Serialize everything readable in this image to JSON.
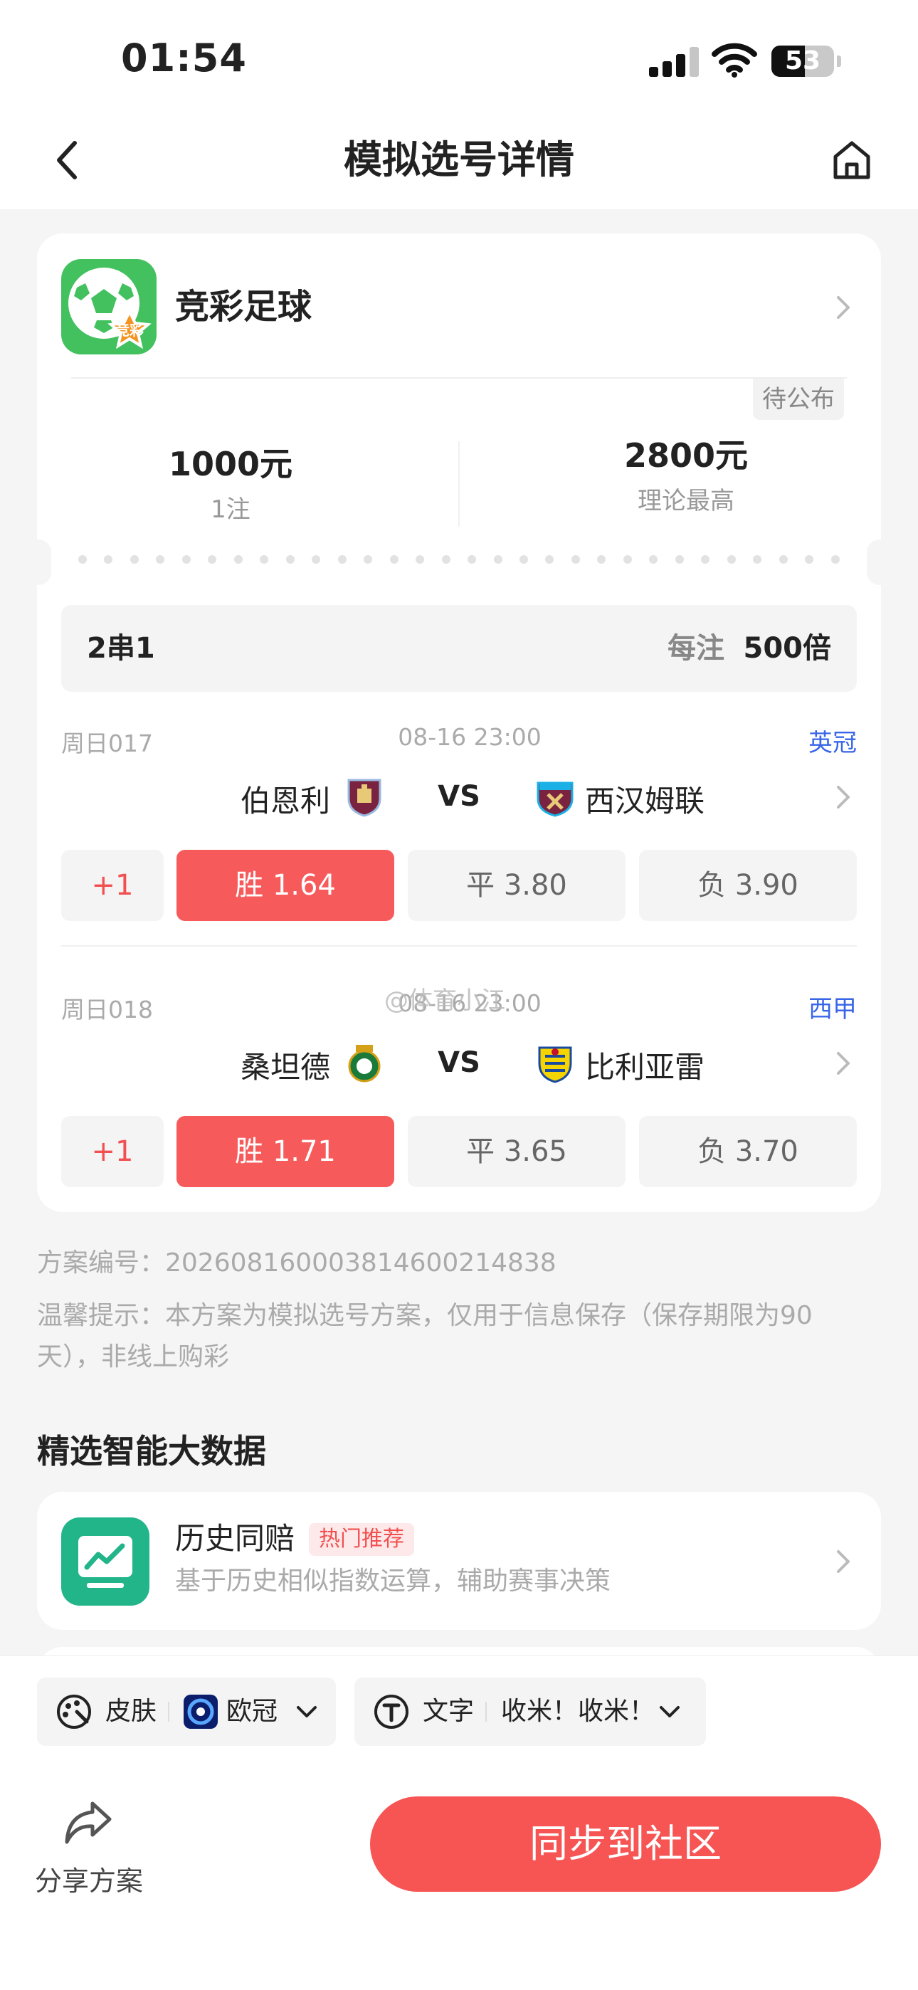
{
  "status_bar": {
    "time": "01:54",
    "battery": "53",
    "battery_level": 0.53
  },
  "nav": {
    "title": "模拟选号详情"
  },
  "lottery": {
    "name": "竞彩足球",
    "icon_badge": "竞彩"
  },
  "ticket": {
    "status": "待公布",
    "stake": "1000元",
    "bets": "1注",
    "max_payout": "2800元",
    "max_payout_label": "理论最高",
    "parlay_type": "2串1",
    "per_bet_label": "每注",
    "multiplier": "500倍"
  },
  "matches": [
    {
      "number": "周日017",
      "time": "08-16 23:00",
      "league": "英冠",
      "home": "伯恩利",
      "vs": "VS",
      "away": "西汉姆联",
      "plus": "+1",
      "odds": [
        {
          "label": "胜 1.64",
          "selected": true
        },
        {
          "label": "平 3.80",
          "selected": false
        },
        {
          "label": "负 3.90",
          "selected": false
        }
      ]
    },
    {
      "number": "周日018",
      "time": "08-16 23:00",
      "league": "西甲",
      "home": "桑坦德",
      "vs": "VS",
      "away": "比利亚雷",
      "plus": "+1",
      "odds": [
        {
          "label": "胜 1.71",
          "selected": true
        },
        {
          "label": "平 3.65",
          "selected": false
        },
        {
          "label": "负 3.70",
          "selected": false
        }
      ]
    }
  ],
  "watermark": "@体育小江",
  "plan": {
    "id_text": "方案编号：20260816000381460021483​8",
    "notice_line1": "温馨提示：本方案为模拟选号方案，仅用于信息保存（保存期限为90",
    "notice_line2": "天），非线上购彩"
  },
  "section": {
    "title": "精选智能大数据"
  },
  "feature": {
    "name": "历史同赔",
    "badge": "热门推荐",
    "desc": "基于历史相似指数运算，辅助赛事决策"
  },
  "toolbar": {
    "skin_label": "皮肤",
    "skin_value": "欧冠",
    "text_label": "文字",
    "text_value": "收米！收米！"
  },
  "bottom": {
    "share_label": "分享方案",
    "sync_label": "同步到社区"
  },
  "colors": {
    "accent": "#f75454",
    "league": "#3966e8",
    "lottery_green": "#43c15e",
    "feature_green": "#22b589"
  },
  "icons": [
    "back-arrow-icon",
    "home-icon",
    "chevron-right-icon",
    "palette-icon",
    "text-t-icon",
    "chevron-down-icon",
    "share-arrow-icon"
  ]
}
